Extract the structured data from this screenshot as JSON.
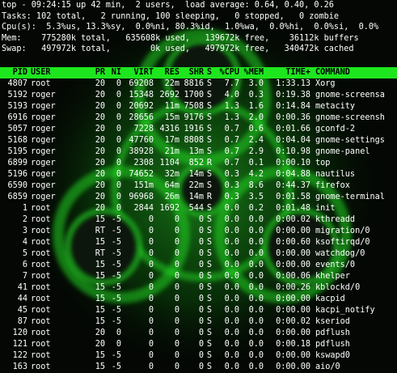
{
  "summary": {
    "top": "top - 09:24:15 up 42 min,  2 users,  load average: 0.64, 0.40, 0.26",
    "tasks": "Tasks: 102 total,   2 running, 100 sleeping,   0 stopped,   0 zombie",
    "cpu": "Cpu(s):  5.3%us, 13.3%sy,  0.0%ni, 80.3%id,  1.0%wa,  0.0%hi,  0.0%si,  0.0%",
    "mem": "Mem:    775280k total,   635608k used,   139672k free,    36112k buffers",
    "swap": "Swap:   497972k total,        0k used,   497972k free,   340472k cached"
  },
  "columns": [
    "PID",
    "USER",
    "PR",
    "NI",
    "VIRT",
    "RES",
    "SHR",
    "S",
    "%CPU",
    "%MEM",
    "TIME+",
    "COMMAND"
  ],
  "processes": [
    [
      "4807",
      "root",
      "20",
      "0",
      "69208",
      "22m",
      "8816",
      "S",
      "7.7",
      "3.0",
      "1:33.13",
      "Xorg"
    ],
    [
      "5192",
      "roger",
      "20",
      "0",
      "15348",
      "2692",
      "1700",
      "S",
      "4.0",
      "0.3",
      "0:19.38",
      "gnome-screensav"
    ],
    [
      "5193",
      "roger",
      "20",
      "0",
      "20692",
      "11m",
      "7508",
      "S",
      "1.3",
      "1.6",
      "0:14.84",
      "metacity"
    ],
    [
      "6916",
      "roger",
      "20",
      "0",
      "28656",
      "15m",
      "9176",
      "S",
      "1.3",
      "2.0",
      "0:00.36",
      "gnome-screensho"
    ],
    [
      "5057",
      "roger",
      "20",
      "0",
      "7228",
      "4316",
      "1916",
      "S",
      "0.7",
      "0.6",
      "0:01.66",
      "gconfd-2"
    ],
    [
      "5168",
      "roger",
      "20",
      "0",
      "47760",
      "17m",
      "8808",
      "S",
      "0.7",
      "2.4",
      "0:04.04",
      "gnome-settings-"
    ],
    [
      "5195",
      "roger",
      "20",
      "0",
      "38928",
      "21m",
      "13m",
      "S",
      "0.7",
      "2.9",
      "0:10.98",
      "gnome-panel"
    ],
    [
      "6899",
      "roger",
      "20",
      "0",
      "2308",
      "1104",
      "852",
      "R",
      "0.7",
      "0.1",
      "0:00.10",
      "top"
    ],
    [
      "5196",
      "roger",
      "20",
      "0",
      "74652",
      "32m",
      "14m",
      "S",
      "0.3",
      "4.2",
      "0:04.88",
      "nautilus"
    ],
    [
      "6590",
      "roger",
      "20",
      "0",
      "151m",
      "64m",
      "22m",
      "S",
      "0.3",
      "8.6",
      "0:44.37",
      "firefox"
    ],
    [
      "6859",
      "roger",
      "20",
      "0",
      "96968",
      "26m",
      "14m",
      "R",
      "0.3",
      "3.5",
      "0:01.58",
      "gnome-terminal"
    ],
    [
      "1",
      "root",
      "20",
      "0",
      "2844",
      "1692",
      "544",
      "S",
      "0.0",
      "0.2",
      "0:01.48",
      "init"
    ],
    [
      "2",
      "root",
      "15",
      "-5",
      "0",
      "0",
      "0",
      "S",
      "0.0",
      "0.0",
      "0:00.02",
      "kthreadd"
    ],
    [
      "3",
      "root",
      "RT",
      "-5",
      "0",
      "0",
      "0",
      "S",
      "0.0",
      "0.0",
      "0:00.00",
      "migration/0"
    ],
    [
      "4",
      "root",
      "15",
      "-5",
      "0",
      "0",
      "0",
      "S",
      "0.0",
      "0.0",
      "0:00.60",
      "ksoftirqd/0"
    ],
    [
      "5",
      "root",
      "RT",
      "-5",
      "0",
      "0",
      "0",
      "S",
      "0.0",
      "0.0",
      "0:00.00",
      "watchdog/0"
    ],
    [
      "6",
      "root",
      "15",
      "-5",
      "0",
      "0",
      "0",
      "S",
      "0.0",
      "0.0",
      "0:00.00",
      "events/0"
    ],
    [
      "7",
      "root",
      "15",
      "-5",
      "0",
      "0",
      "0",
      "S",
      "0.0",
      "0.0",
      "0:00.06",
      "khelper"
    ],
    [
      "41",
      "root",
      "15",
      "-5",
      "0",
      "0",
      "0",
      "S",
      "0.0",
      "0.0",
      "0:00.26",
      "kblockd/0"
    ],
    [
      "44",
      "root",
      "15",
      "-5",
      "0",
      "0",
      "0",
      "S",
      "0.0",
      "0.0",
      "0:00.00",
      "kacpid"
    ],
    [
      "45",
      "root",
      "15",
      "-5",
      "0",
      "0",
      "0",
      "S",
      "0.0",
      "0.0",
      "0:00.00",
      "kacpi_notify"
    ],
    [
      "87",
      "root",
      "15",
      "-5",
      "0",
      "0",
      "0",
      "S",
      "0.0",
      "0.0",
      "0:00.02",
      "kseriod"
    ],
    [
      "120",
      "root",
      "20",
      "0",
      "0",
      "0",
      "0",
      "S",
      "0.0",
      "0.0",
      "0:00.00",
      "pdflush"
    ],
    [
      "121",
      "root",
      "20",
      "0",
      "0",
      "0",
      "0",
      "S",
      "0.0",
      "0.0",
      "0:00.18",
      "pdflush"
    ],
    [
      "122",
      "root",
      "15",
      "-5",
      "0",
      "0",
      "0",
      "S",
      "0.0",
      "0.0",
      "0:00.00",
      "kswapd0"
    ],
    [
      "163",
      "root",
      "15",
      "-5",
      "0",
      "0",
      "0",
      "S",
      "0.0",
      "0.0",
      "0:00.00",
      "aio/0"
    ]
  ],
  "colors": {
    "background": "#050805",
    "text": "#ffffff",
    "header_bar": "#1ee61e",
    "glow": "#1fd41f"
  },
  "icons": {
    "wallpaper": "biohazard-symbol"
  }
}
